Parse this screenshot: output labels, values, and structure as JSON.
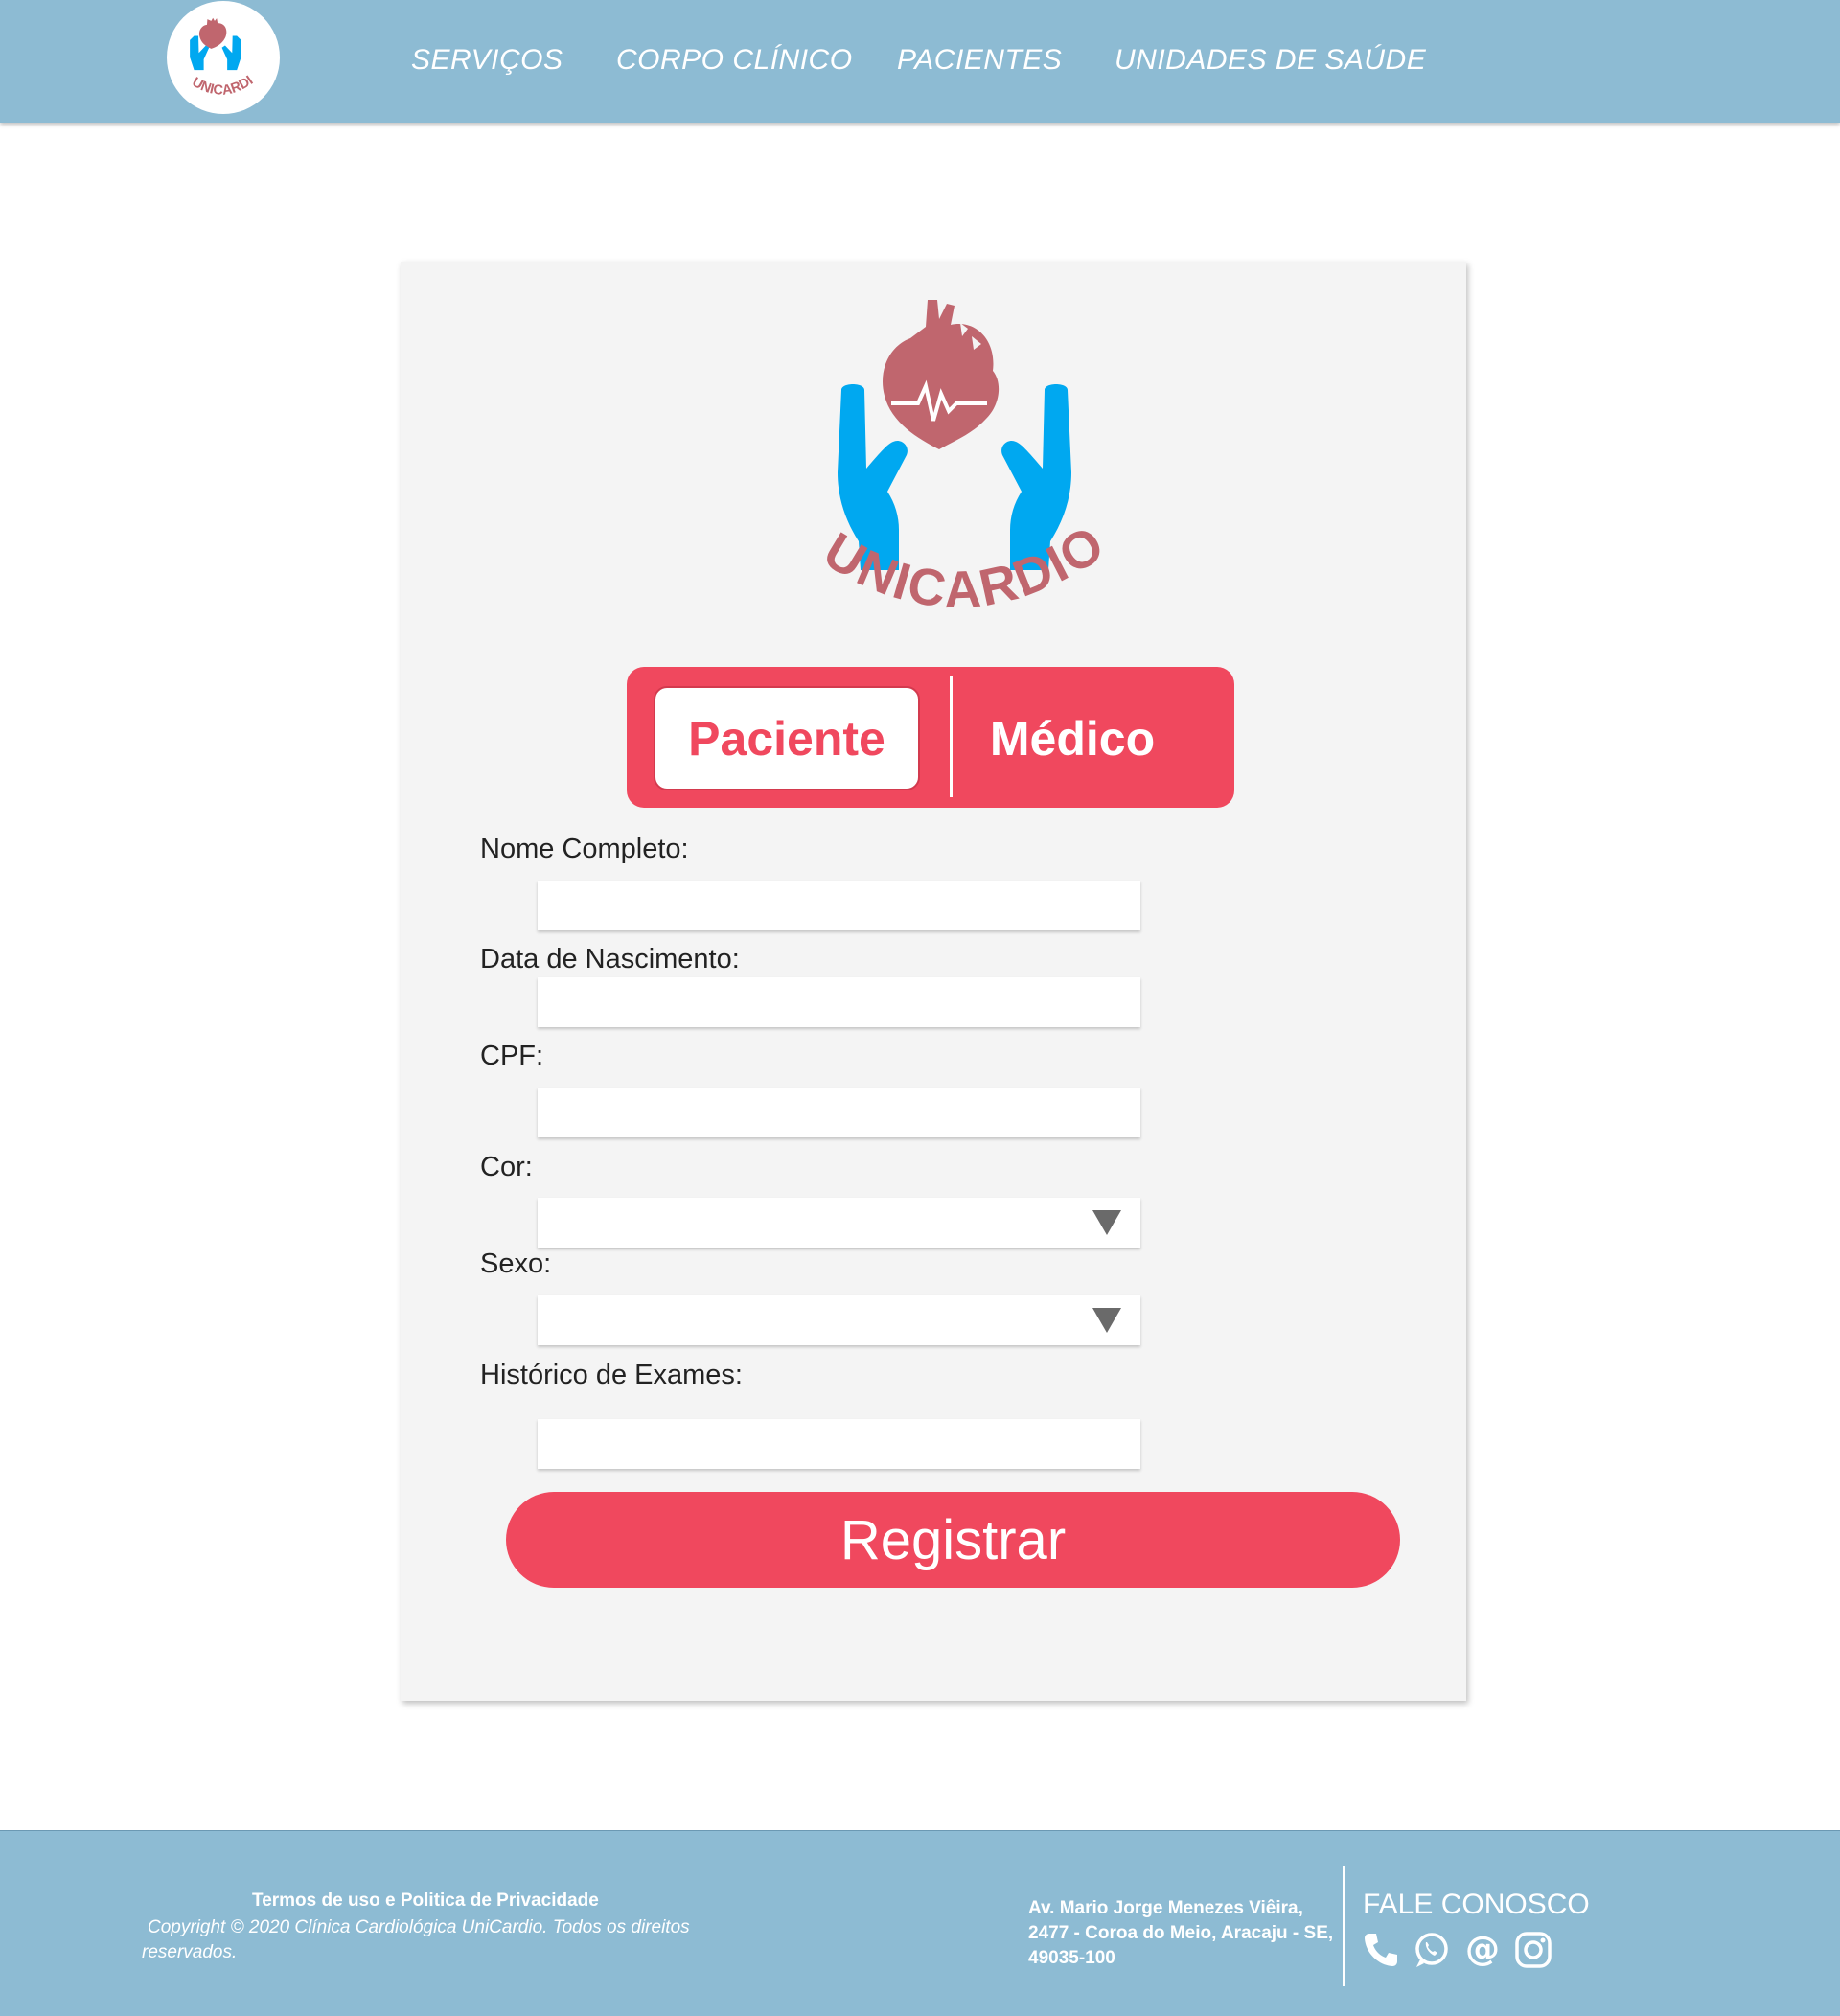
{
  "header": {
    "nav": [
      {
        "label": "SERVIÇOS"
      },
      {
        "label": "CORPO CLÍNICO"
      },
      {
        "label": "PACIENTES"
      },
      {
        "label": "UNIDADES DE SAÚDE"
      }
    ]
  },
  "brand": {
    "name": "UNICARDIO",
    "colors": {
      "heart": "#c0666e",
      "hands": "#00a8f0",
      "accent": "#f0485e",
      "bar": "#8dbbd3"
    }
  },
  "toggle": {
    "active_label": "Paciente",
    "inactive_label": "Médico"
  },
  "form": {
    "fields": [
      {
        "label": "Nome Completo:",
        "value": ""
      },
      {
        "label": "Data de Nascimento:",
        "value": ""
      },
      {
        "label": "CPF:",
        "value": ""
      },
      {
        "label": "Cor:",
        "value": ""
      },
      {
        "label": "Sexo:",
        "value": ""
      },
      {
        "label": "Histórico de Exames:",
        "value": ""
      }
    ],
    "submit_label": "Registrar"
  },
  "footer": {
    "terms": "Termos de uso e Politica de Privacidade",
    "copyright": "Copyright © 2020 Clínica Cardiológica UniCardio. Todos os direitos reservados.",
    "address": "Av. Mario Jorge Menezes Viêira, 2477 - Coroa do Meio, Aracaju - SE, 49035-100",
    "contact_title": "FALE CONOSCO",
    "icons": [
      "phone-icon",
      "whatsapp-icon",
      "email-at-icon",
      "instagram-icon"
    ]
  }
}
